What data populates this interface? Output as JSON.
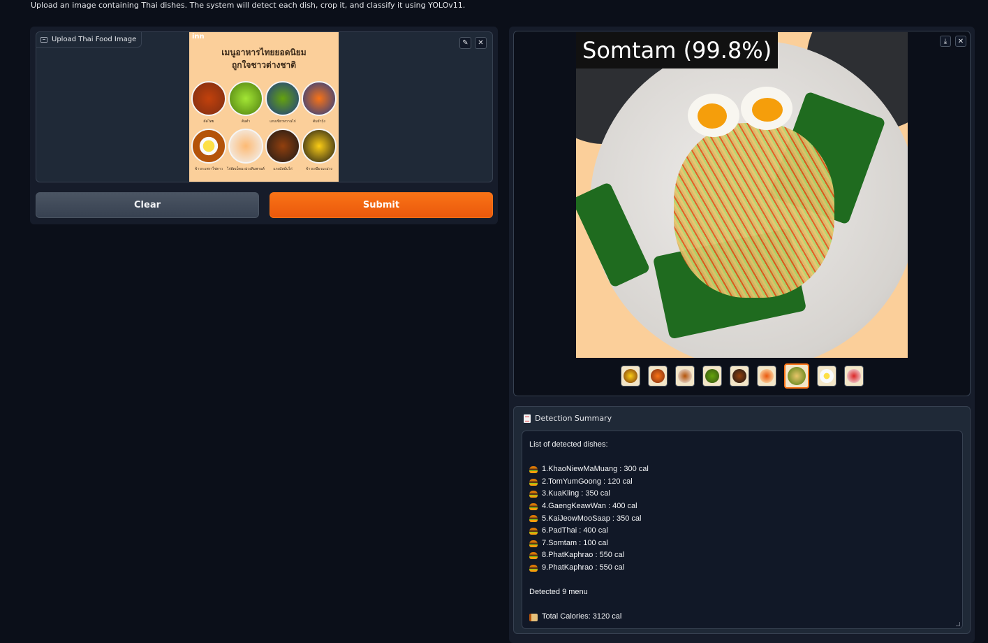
{
  "description": "Upload an image containing Thai dishes. The system will detect each dish, crop it, and classify it using YOLOv11.",
  "upload": {
    "label": "Upload Thai Food Image",
    "edit_icon": "pencil-icon",
    "close_icon": "close-icon",
    "poster": {
      "brand": "inn",
      "title_line1": "เมนูอาหารไทยยอดนิยม",
      "title_line2": "ถูกใจชาวต่างชาติ",
      "dishes": [
        "ผัดไทย",
        "ส้มตำ",
        "แกงเขียวหวานไก่",
        "ต้มยำกุ้ง",
        "ข้าวกะเพราไข่ดาว",
        "ไก่ผัดเม็ดมะม่วงหิมพานต์",
        "แกงมัสมั่นไก่",
        "ข้าวเหนียวมะม่วง"
      ]
    }
  },
  "buttons": {
    "clear": "Clear",
    "submit": "Submit"
  },
  "gallery": {
    "prediction_label": "Somtam (99.8%)",
    "download_icon": "download-icon",
    "close_icon": "close-icon",
    "thumbnail_count": 9,
    "selected_index": 6
  },
  "summary": {
    "label": "Detection Summary",
    "header": "List of detected dishes:",
    "items": [
      "1.KhaoNiewMaMuang : 300 cal",
      "2.TomYumGoong : 120 cal",
      "3.KuaKling : 350 cal",
      "4.GaengKeawWan : 400 cal",
      "5.KaiJeowMooSaap : 350 cal",
      "6.PadThai : 400 cal",
      "7.Somtam : 100 cal",
      "8.PhatKaphrao : 550 cal",
      "9.PhatKaphrao : 550 cal"
    ],
    "detected": "Detected 9 menu",
    "total": "Total Calories: 3120 cal"
  },
  "colors": {
    "accent": "#f97316",
    "background": "#0b0f19",
    "panel": "#1f2937"
  }
}
